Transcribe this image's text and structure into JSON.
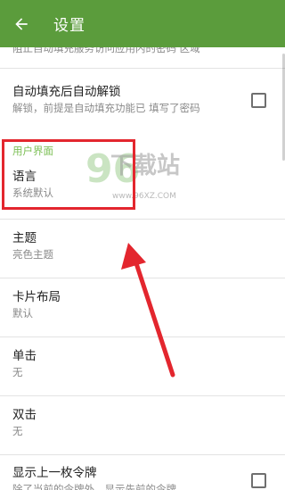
{
  "appbar": {
    "title": "设置",
    "back_icon": "arrow-back-icon",
    "color": "#5b9c3c"
  },
  "rows": {
    "partial_top": {
      "summary": "阻止自动填充服务访问应用内的密码 区域",
      "checked": false
    },
    "autofill_unlock": {
      "title": "自动填充后自动解锁",
      "summary": "解锁，前提是自动填充功能已 填写了密码",
      "checked": false
    },
    "section_ui": {
      "header": "用户界面"
    },
    "language": {
      "title": "语言",
      "summary": "系统默认"
    },
    "theme": {
      "title": "主题",
      "summary": "亮色主题"
    },
    "card_layout": {
      "title": "卡片布局",
      "summary": "默认"
    },
    "single_tap": {
      "title": "单击",
      "summary": "无"
    },
    "double_tap": {
      "title": "双击",
      "summary": "无"
    },
    "show_previous": {
      "title": "显示上一枚令牌",
      "summary": "除了当前的令牌外，显示先前的令牌",
      "checked": false
    }
  },
  "watermark": {
    "number": "96",
    "text": "下载站",
    "url": "www.96XZ.COM"
  },
  "colors": {
    "accent_section": "#7cbf55",
    "highlight": "#e3262e",
    "arrow": "#e3262e"
  }
}
